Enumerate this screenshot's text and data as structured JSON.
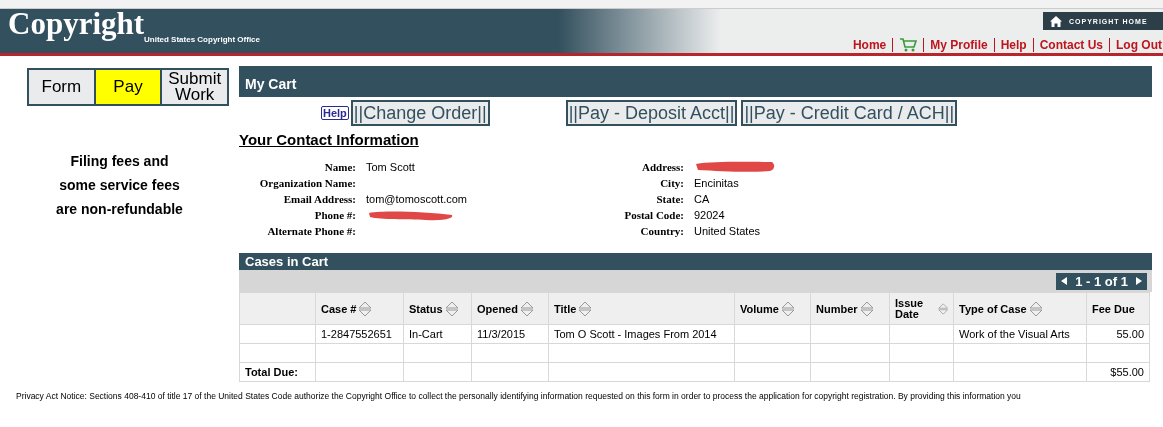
{
  "header": {
    "logo": "Copyright",
    "subtitle": "United States Copyright Office",
    "home_button": "COPYRIGHT HOME",
    "links": [
      {
        "kind": "text",
        "label": "Home"
      },
      {
        "kind": "cart"
      },
      {
        "kind": "text",
        "label": "My Profile"
      },
      {
        "kind": "text",
        "label": "Help"
      },
      {
        "kind": "text",
        "label": "Contact Us"
      },
      {
        "kind": "text",
        "label": "Log Out"
      }
    ]
  },
  "steps": [
    {
      "label": "Form",
      "selected": false
    },
    {
      "label": "Pay",
      "selected": true
    },
    {
      "label": "Submit Work",
      "selected": false
    }
  ],
  "notice": [
    "Filing fees and",
    "some service fees",
    "are non-refundable"
  ],
  "cart": {
    "title": "My Cart",
    "help": "Help",
    "action_groups": [
      [
        "||Change Order||"
      ],
      [
        "||Pay - Deposit Acct||",
        "||Pay - Credit Card / ACH||"
      ]
    ]
  },
  "contact": {
    "title": "Your Contact Information",
    "left": [
      {
        "label": "Name:",
        "value": "Tom Scott",
        "redacted": false
      },
      {
        "label": "Organization Name:",
        "redacted": false
      },
      {
        "label": "Email Address:",
        "value": "tom@tomoscott.com",
        "redacted": false
      },
      {
        "label": "Phone #:",
        "redacted": true
      },
      {
        "label": "Alternate Phone #:",
        "redacted": false
      }
    ],
    "right": [
      {
        "label": "Address:",
        "redacted": true
      },
      {
        "label": "City:",
        "value": "Encinitas",
        "redacted": false
      },
      {
        "label": "State:",
        "value": "CA",
        "redacted": false
      },
      {
        "label": "Postal Code:",
        "value": "92024",
        "redacted": false
      },
      {
        "label": "Country:",
        "value": "United States",
        "redacted": false
      }
    ]
  },
  "cases": {
    "title": "Cases in Cart",
    "pager": "1 - 1 of 1",
    "columns": [
      {
        "sortable": false
      },
      {
        "label": "Case #",
        "sortable": true
      },
      {
        "label": "Status",
        "sortable": true
      },
      {
        "label": "Opened",
        "sortable": true
      },
      {
        "label": "Title",
        "sortable": true
      },
      {
        "label": "Volume",
        "sortable": true
      },
      {
        "label": "Number",
        "sortable": true
      },
      {
        "label": "Issue Date",
        "sortable": true
      },
      {
        "label": "Type of Case",
        "sortable": true
      },
      {
        "label": "Fee Due",
        "sortable": false
      }
    ],
    "rows": [
      [
        "",
        "1-2847552651",
        "In-Cart",
        "11/3/2015",
        "Tom O Scott - Images From 2014",
        "",
        "",
        "",
        "Work of the Visual Arts",
        "55.00"
      ],
      [
        "",
        "",
        "",
        "",
        "",
        "",
        "",
        "",
        "",
        ""
      ]
    ],
    "total_label": "Total Due:",
    "total": "$55.00"
  },
  "privacy": "Privacy Act Notice: Sections 408-410 of title 17 of the United States Code authorize the Copyright Office to collect the personally identifying information requested on this form in order to process the application for copyright registration. By providing this information you"
}
